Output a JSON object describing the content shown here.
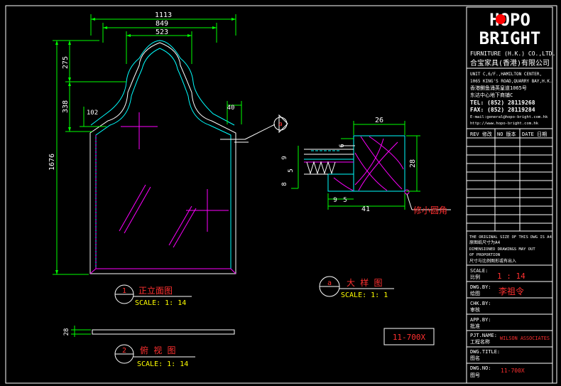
{
  "colors": {
    "background": "#000000",
    "frame": "#ffffff",
    "dimension": "#00ff00",
    "frame_line": "#00ffff",
    "hatch": "#ff00ff",
    "label_red": "#ff3030",
    "label_yellow": "#ffff00",
    "logo_red": "#ff0000"
  },
  "dimensions": {
    "width_outer": "1113",
    "width_mid": "849",
    "width_inner": "523",
    "height_top": "275",
    "height_mid": "338",
    "height_small": "102",
    "height_total": "1676",
    "edge": "40",
    "plan_depth": "28",
    "detail_top": "26",
    "detail_right": "28",
    "detail_a": "6",
    "detail_b": "9",
    "detail_c": "5",
    "detail_d": "8",
    "detail_e": "9",
    "detail_f": "5",
    "detail_bottom": "41"
  },
  "callout": {
    "detail_marker": "a",
    "note": "修小圆角"
  },
  "views": {
    "front": {
      "number": "1",
      "title": "正立面图",
      "scale": "SCALE: 1: 14"
    },
    "plan": {
      "number": "2",
      "title": "俯 视 图",
      "scale": "SCALE: 1: 14"
    },
    "detail": {
      "number": "a",
      "title": "大 样 图",
      "scale": "SCALE: 1: 1"
    }
  },
  "model_code": "11-700X",
  "title_block": {
    "logo_top": "HOPO",
    "logo_bottom": "BRIGHT",
    "company_en": "FURNITURE (H.K.) CO.,LTD.",
    "company_cn": "合宝家具(香港)有限公司",
    "address": [
      "UNIT C,6/F.,HAMILTON CENTER,",
      "1065 KING'S ROAD,QUARRY BAY,H.K.",
      "香港鲗鱼涌英皇道1065号",
      "东达中心地下商铺C"
    ],
    "tel": "TEL: (852) 28119268",
    "fax": "FAX: (852) 28119284",
    "email": "E-mail:general@hopo-bright.com.hk",
    "web": "http://www.hopo-bright.com.hk",
    "rev_headers": [
      "REV 修改",
      "NO 版本",
      "DATE 日期"
    ],
    "notes": [
      "THE ORIGINAL SIZE OF THIS DWG IS A4",
      "原图纸尺寸为A4",
      "DIMENSIONED DRAWINGS MAY OUT",
      "OF PROPORTION",
      "尺寸与比例图形或有出入"
    ],
    "scale_label_en": "SCALE:",
    "scale_label_cn": "比例",
    "scale_value": "1 : 14",
    "dwg_by_en": "DWG.BY:",
    "dwg_by_cn": "绘图",
    "dwg_by_value": "李祖令",
    "chk_by_en": "CHK.BY:",
    "chk_by_cn": "审核",
    "app_by_en": "APP.BY:",
    "app_by_cn": "批准",
    "pjt_name_en": "PJT.NAME:",
    "pjt_name_cn": "工程名称",
    "pjt_name_value": "WILSON ASSOCIATES",
    "dwg_title_en": "DWG.TITLE:",
    "dwg_title_cn": "图名",
    "dwg_no_en": "DWG.NO:",
    "dwg_no_cn": "图号",
    "dwg_no_value": "11-700X"
  }
}
